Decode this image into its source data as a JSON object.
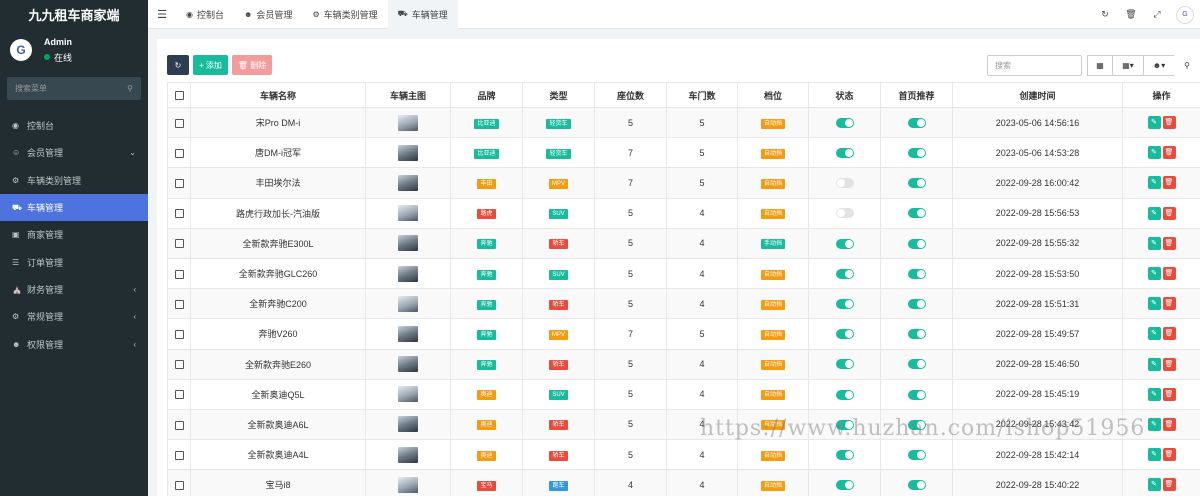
{
  "sidebar": {
    "brand": "九九租车商家端",
    "user": {
      "name": "Admin",
      "status": "在线"
    },
    "search_placeholder": "搜索菜单",
    "items": [
      {
        "label": "控制台",
        "icon": "dashboard-icon",
        "arrow": ""
      },
      {
        "label": "会员管理",
        "icon": "users-icon",
        "arrow": "⌄"
      },
      {
        "label": "车辆类别管理",
        "icon": "gear-icon",
        "arrow": ""
      },
      {
        "label": "车辆管理",
        "icon": "car-icon",
        "arrow": "",
        "active": true
      },
      {
        "label": "商家管理",
        "icon": "store-icon",
        "arrow": ""
      },
      {
        "label": "订单管理",
        "icon": "order-icon",
        "arrow": ""
      },
      {
        "label": "财务管理",
        "icon": "bank-icon",
        "arrow": "‹"
      },
      {
        "label": "常规管理",
        "icon": "cogs-icon",
        "arrow": "‹"
      },
      {
        "label": "权限管理",
        "icon": "group-icon",
        "arrow": "‹"
      }
    ]
  },
  "topbar": {
    "tabs": [
      {
        "label": "控制台"
      },
      {
        "label": "会员管理"
      },
      {
        "label": "车辆类别管理"
      },
      {
        "label": "车辆管理",
        "active": true
      }
    ]
  },
  "toolbar": {
    "add_label": "添加",
    "delete_label": "删除",
    "search_placeholder": "搜索"
  },
  "table": {
    "headers": [
      "车辆名称",
      "车辆主图",
      "品牌",
      "类型",
      "座位数",
      "车门数",
      "档位",
      "状态",
      "首页推荐",
      "创建时间",
      "操作"
    ],
    "rows": [
      {
        "name": "宋Pro DM-i",
        "brand": "比亚迪",
        "brand_color": "green",
        "type": "轻货车",
        "type_color": "green",
        "seats": "5",
        "doors": "5",
        "gear": "自动挡",
        "gear_color": "orange",
        "status_on": true,
        "recommend_on": true,
        "created": "2023-05-06 14:56:16"
      },
      {
        "name": "唐DM-i冠军",
        "brand": "比亚迪",
        "brand_color": "green",
        "type": "轻货车",
        "type_color": "green",
        "seats": "7",
        "doors": "5",
        "gear": "自动挡",
        "gear_color": "orange",
        "status_on": true,
        "recommend_on": true,
        "created": "2023-05-06 14:53:28"
      },
      {
        "name": "丰田埃尔法",
        "brand": "丰田",
        "brand_color": "orange",
        "type": "MPV",
        "type_color": "orange",
        "seats": "7",
        "doors": "5",
        "gear": "自动挡",
        "gear_color": "orange",
        "status_on": false,
        "recommend_on": true,
        "created": "2022-09-28 16:00:42"
      },
      {
        "name": "路虎行政加长-汽油版",
        "brand": "路虎",
        "brand_color": "red",
        "type": "SUV",
        "type_color": "green",
        "seats": "5",
        "doors": "4",
        "gear": "自动挡",
        "gear_color": "orange",
        "status_on": false,
        "recommend_on": true,
        "created": "2022-09-28 15:56:53"
      },
      {
        "name": "全新款奔驰E300L",
        "brand": "奔驰",
        "brand_color": "green",
        "type": "轿车",
        "type_color": "red",
        "seats": "5",
        "doors": "4",
        "gear": "手动挡",
        "gear_color": "green",
        "status_on": true,
        "recommend_on": true,
        "created": "2022-09-28 15:55:32"
      },
      {
        "name": "全新款奔驰GLC260",
        "brand": "奔驰",
        "brand_color": "green",
        "type": "SUV",
        "type_color": "green",
        "seats": "5",
        "doors": "4",
        "gear": "自动挡",
        "gear_color": "orange",
        "status_on": true,
        "recommend_on": true,
        "created": "2022-09-28 15:53:50"
      },
      {
        "name": "全新奔驰C200",
        "brand": "奔驰",
        "brand_color": "green",
        "type": "轿车",
        "type_color": "red",
        "seats": "5",
        "doors": "4",
        "gear": "自动挡",
        "gear_color": "orange",
        "status_on": true,
        "recommend_on": true,
        "created": "2022-09-28 15:51:31"
      },
      {
        "name": "奔驰V260",
        "brand": "奔驰",
        "brand_color": "green",
        "type": "MPV",
        "type_color": "orange",
        "seats": "7",
        "doors": "5",
        "gear": "自动挡",
        "gear_color": "orange",
        "status_on": true,
        "recommend_on": true,
        "created": "2022-09-28 15:49:57"
      },
      {
        "name": "全新款奔驰E260",
        "brand": "奔驰",
        "brand_color": "green",
        "type": "轿车",
        "type_color": "red",
        "seats": "5",
        "doors": "4",
        "gear": "自动挡",
        "gear_color": "orange",
        "status_on": true,
        "recommend_on": true,
        "created": "2022-09-28 15:46:50"
      },
      {
        "name": "全新奥迪Q5L",
        "brand": "奥迪",
        "brand_color": "orange",
        "type": "SUV",
        "type_color": "green",
        "seats": "5",
        "doors": "4",
        "gear": "自动挡",
        "gear_color": "orange",
        "status_on": true,
        "recommend_on": true,
        "created": "2022-09-28 15:45:19"
      },
      {
        "name": "全新款奥迪A6L",
        "brand": "奥迪",
        "brand_color": "orange",
        "type": "轿车",
        "type_color": "red",
        "seats": "5",
        "doors": "4",
        "gear": "自动挡",
        "gear_color": "orange",
        "status_on": true,
        "recommend_on": true,
        "created": "2022-09-28 15:43:42"
      },
      {
        "name": "全新款奥迪A4L",
        "brand": "奥迪",
        "brand_color": "orange",
        "type": "轿车",
        "type_color": "red",
        "seats": "5",
        "doors": "4",
        "gear": "自动挡",
        "gear_color": "orange",
        "status_on": true,
        "recommend_on": true,
        "created": "2022-09-28 15:42:14"
      },
      {
        "name": "宝马i8",
        "brand": "宝马",
        "brand_color": "red",
        "type": "跑车",
        "type_color": "blue",
        "seats": "4",
        "doors": "4",
        "gear": "自动挡",
        "gear_color": "orange",
        "status_on": true,
        "recommend_on": true,
        "created": "2022-09-28 15:40:22"
      }
    ]
  },
  "watermark": "https://www.huzhan.com/ishop51956",
  "colors": {
    "sidebar_bg": "#222d32",
    "active_nav": "#4e73df",
    "success": "#18bc9c",
    "danger": "#e74c3c",
    "warning": "#f39c12"
  }
}
